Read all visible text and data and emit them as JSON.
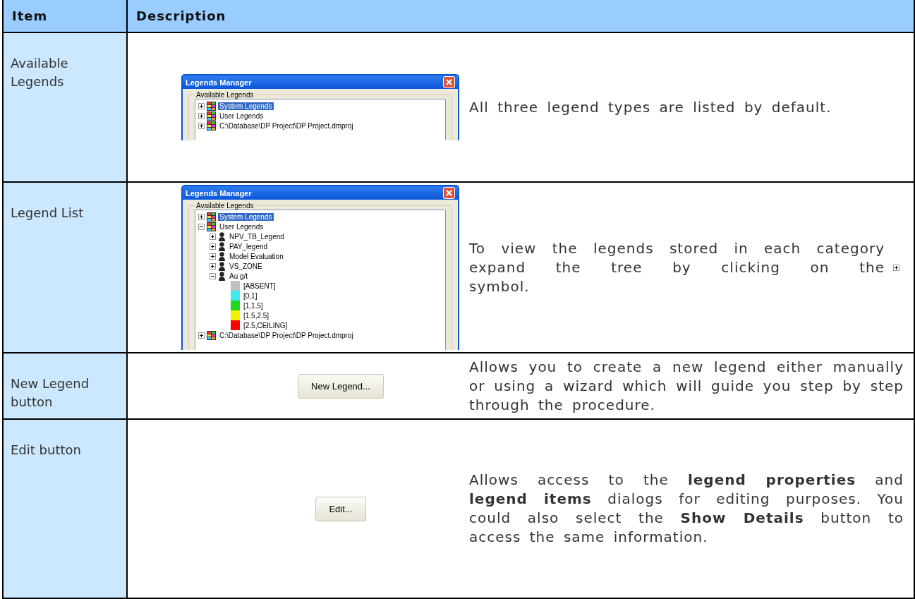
{
  "table": {
    "columns": [
      "Item",
      "Description"
    ],
    "rows": [
      {
        "item": "Available Legends",
        "figure": {
          "kind": "dialog",
          "title": "Legends Manager",
          "group": "Available Legends",
          "tree": [
            {
              "label": "System Legends",
              "kind": "category",
              "selected": true,
              "expanded": false
            },
            {
              "label": "User Legends",
              "kind": "category",
              "selected": false,
              "expanded": false
            },
            {
              "label": "C:\\Database\\DP Project\\DP Project.dmproj",
              "kind": "category",
              "selected": false,
              "expanded": false
            }
          ]
        },
        "description": [
          {
            "kind": "text",
            "text": "All three legend types are listed by default."
          }
        ]
      },
      {
        "item": "Legend List",
        "figure": {
          "kind": "dialog",
          "title": "Legends Manager",
          "group": "Available Legends",
          "tree": [
            {
              "label": "System Legends",
              "kind": "category",
              "selected": true,
              "expanded": false
            },
            {
              "label": "User Legends",
              "kind": "category",
              "selected": false,
              "expanded": true,
              "children": [
                {
                  "label": "NPV_TB_Legend",
                  "kind": "legend",
                  "selected": false,
                  "expanded": false
                },
                {
                  "label": "PAY_legend",
                  "kind": "legend",
                  "selected": false,
                  "expanded": false
                },
                {
                  "label": "Model Evaluation",
                  "kind": "legend",
                  "selected": false,
                  "expanded": false
                },
                {
                  "label": "VS_ZONE",
                  "kind": "legend",
                  "selected": false,
                  "expanded": false
                },
                {
                  "label": "Au g/t",
                  "kind": "legend",
                  "selected": false,
                  "expanded": true,
                  "children": [
                    {
                      "label": "[ABSENT]",
                      "kind": "swatch",
                      "selected": false,
                      "color": "#c0c0c0"
                    },
                    {
                      "label": "[0,1]",
                      "kind": "swatch",
                      "selected": false,
                      "color": "#3ee8ee"
                    },
                    {
                      "label": "[1,1.5]",
                      "kind": "swatch",
                      "selected": false,
                      "color": "#1ed81e"
                    },
                    {
                      "label": "[1.5,2.5]",
                      "kind": "swatch",
                      "selected": false,
                      "color": "#f2f200"
                    },
                    {
                      "label": "[2.5,CEILING]",
                      "kind": "swatch",
                      "selected": false,
                      "color": "#ff0000"
                    }
                  ]
                }
              ]
            },
            {
              "label": "C:\\Database\\DP Project\\DP Project.dmproj",
              "kind": "category",
              "selected": false,
              "expanded": false
            }
          ]
        },
        "description": [
          {
            "kind": "text",
            "text": "To view the legends stored in each category expand the tree by clicking on the"
          },
          {
            "kind": "expand_icon"
          },
          {
            "kind": "text",
            "text": "symbol."
          }
        ]
      },
      {
        "item": "New Legend button",
        "figure": {
          "kind": "button",
          "label": "New Legend..."
        },
        "description": [
          {
            "kind": "text",
            "text": "Allows you to create a new legend either manually or using a wizard which will guide you step by step through the procedure."
          }
        ]
      },
      {
        "item": "Edit button",
        "figure": {
          "kind": "button",
          "label": "Edit..."
        },
        "description": [
          {
            "kind": "text",
            "text": "Allows access to the **legend properties** and **legend items** dialogs for editing purposes.  You could also select the **Show Details** button to access the same information."
          }
        ]
      }
    ]
  }
}
